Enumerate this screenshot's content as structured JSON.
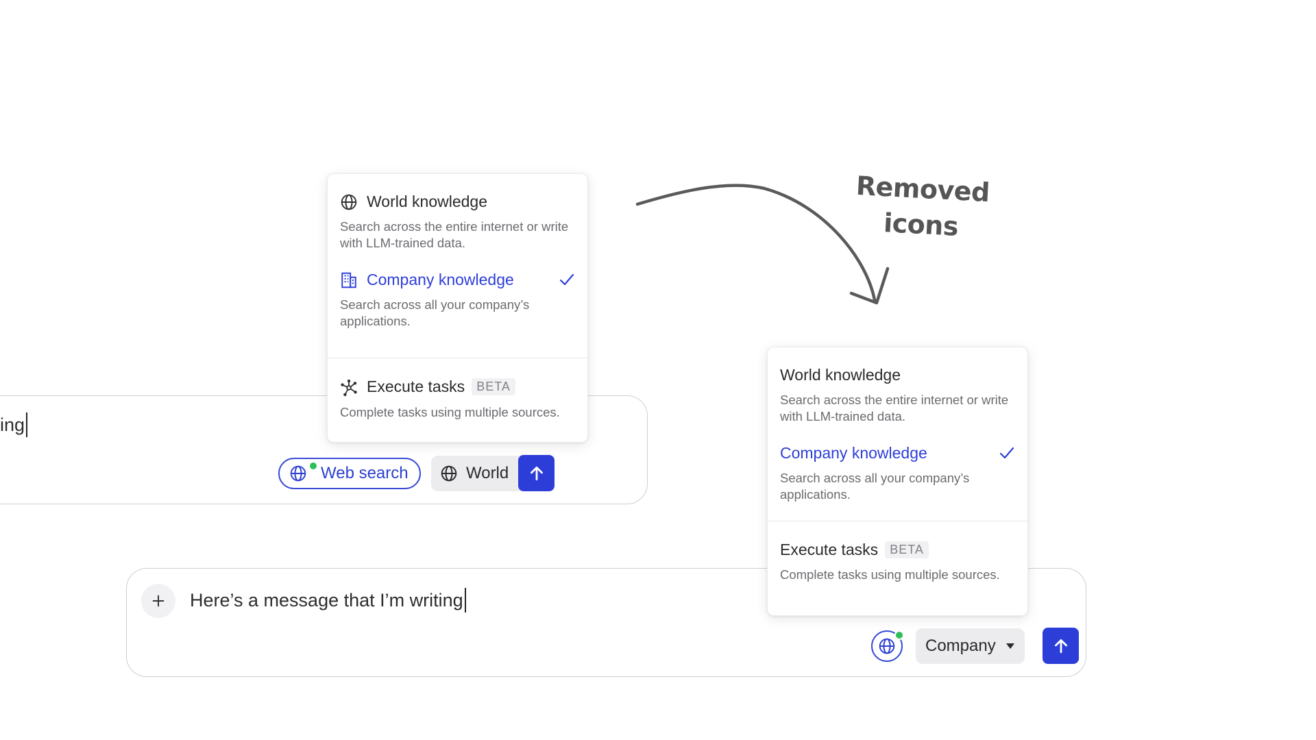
{
  "composer_1": {
    "text": "ing",
    "web_search_label": "Web search",
    "source_label": "World"
  },
  "composer_2": {
    "text": "Here’s a message that I’m writing",
    "source_label": "Company"
  },
  "menu_1": {
    "items": [
      {
        "title": "World knowledge",
        "desc": "Search across the entire internet or write with LLM-trained data.",
        "icon": "globe-icon"
      },
      {
        "title": "Company knowledge",
        "desc": "Search across all your company’s applications.",
        "icon": "building-icon",
        "selected": true
      },
      {
        "title": "Execute tasks",
        "badge": "BETA",
        "desc": "Complete tasks using multiple sources.",
        "icon": "network-icon"
      }
    ]
  },
  "menu_2": {
    "items": [
      {
        "title": "World knowledge",
        "desc": "Search across the entire internet or write with LLM-trained data."
      },
      {
        "title": "Company knowledge",
        "desc": "Search across all your company’s applications.",
        "selected": true
      },
      {
        "title": "Execute tasks",
        "badge": "BETA",
        "desc": "Complete tasks using multiple sources."
      }
    ]
  },
  "annotation": {
    "line1": "Removed",
    "line2": "icons"
  },
  "colors": {
    "accent": "#2d3ed8",
    "status_dot": "#2fbf5a",
    "chip_bg": "#ececef"
  }
}
